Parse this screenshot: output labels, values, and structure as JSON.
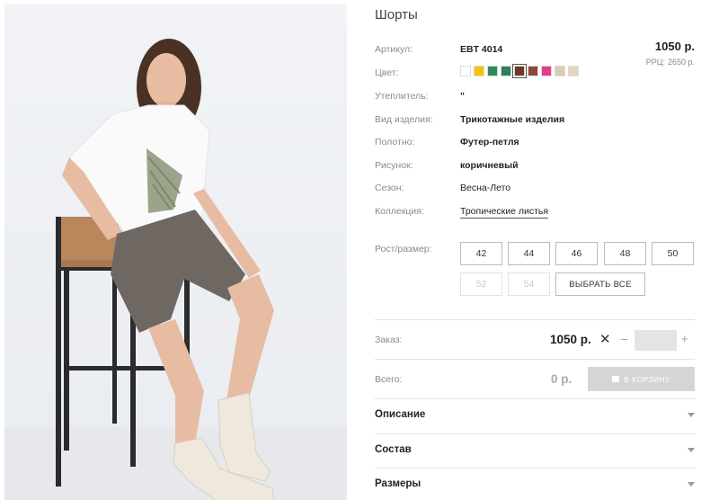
{
  "product": {
    "title": "Шорты",
    "price": "1050 р.",
    "rrc_label": "РРЦ:",
    "rrc_value": "2650 р."
  },
  "attributes": [
    {
      "label": "Артикул:",
      "value": "EBT 4014"
    },
    {
      "label": "Цвет:",
      "value": ""
    },
    {
      "label": "Утеплитель:",
      "value": "\""
    },
    {
      "label": "Вид изделия:",
      "value": "Трикотажные изделия"
    },
    {
      "label": "Полотно:",
      "value": "Футер-петля"
    },
    {
      "label": "Рисунок:",
      "value": "коричневый"
    },
    {
      "label": "Сезон:",
      "value": "Весна-Лето"
    },
    {
      "label": "Коллекция:",
      "value": "Тропические листья"
    }
  ],
  "colors": [
    {
      "hex": "#ffffff",
      "selected": false
    },
    {
      "hex": "#f5c400",
      "selected": false
    },
    {
      "hex": "#2e8b57",
      "selected": false
    },
    {
      "hex": "#2f7f5a",
      "selected": false
    },
    {
      "hex": "#6b3a22",
      "selected": true
    },
    {
      "hex": "#8a4a35",
      "selected": false
    },
    {
      "hex": "#e83a8c",
      "selected": false
    },
    {
      "hex": "#d9ccb0",
      "selected": false
    },
    {
      "hex": "#e3d5b8",
      "selected": false
    }
  ],
  "sizes": {
    "label": "Рост/размер:",
    "available": [
      "42",
      "44",
      "46",
      "48",
      "50"
    ],
    "unavailable": [
      "52",
      "54"
    ],
    "select_all": "ВЫБРАТЬ ВСЕ"
  },
  "order": {
    "label": "Заказ:",
    "price": "1050 р.",
    "times": "✕",
    "minus": "–",
    "plus": "+",
    "quantity": ""
  },
  "total": {
    "label": "Всего:",
    "value": "0 р.",
    "cart_button": "В КОРЗИНУ"
  },
  "accordion": [
    "Описание",
    "Состав",
    "Размеры"
  ]
}
